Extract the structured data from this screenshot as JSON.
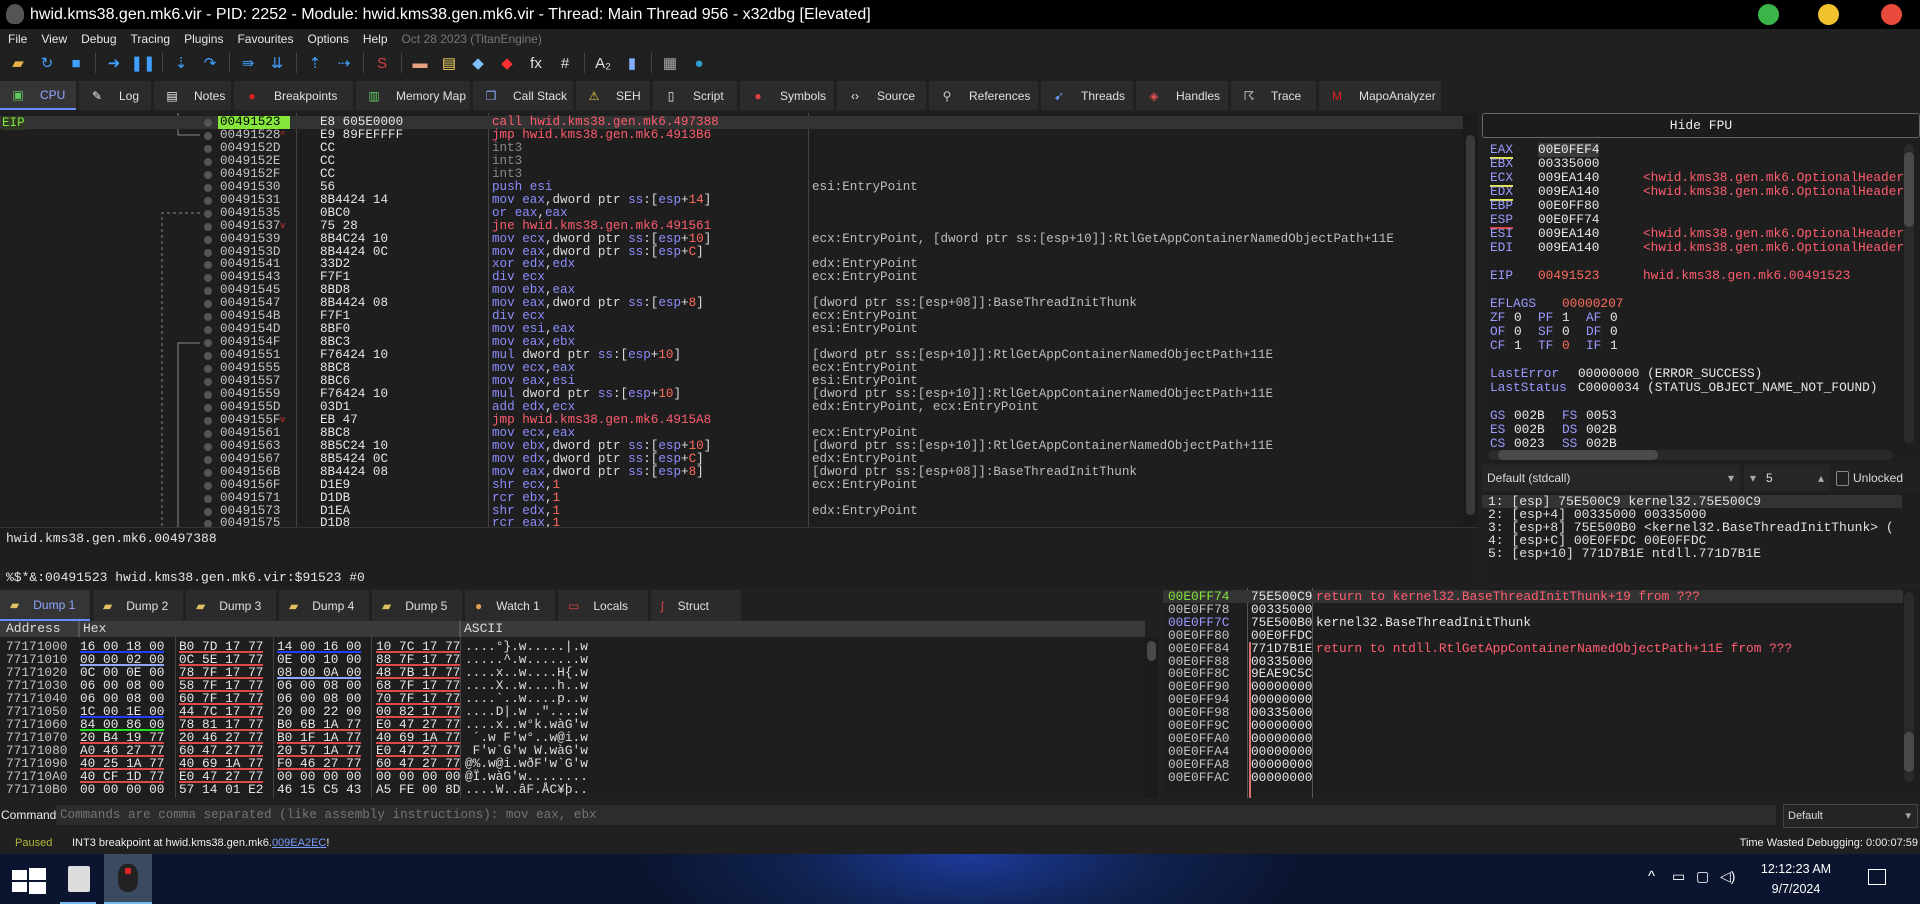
{
  "window": {
    "title": "hwid.kms38.gen.mk6.vir - PID: 2252 - Module: hwid.kms38.gen.mk6.vir - Thread: Main Thread 956 - x32dbg [Elevated]",
    "controls": {
      "minimize": "#3bb54a",
      "maximize": "#f2c12e",
      "close": "#e84b3c"
    }
  },
  "menu": {
    "items": [
      "File",
      "View",
      "Debug",
      "Tracing",
      "Plugins",
      "Favourites",
      "Options",
      "Help"
    ],
    "version": "Oct 28 2023 (TitanEngine)"
  },
  "toolbar": [
    {
      "icon": "open-folder-icon",
      "g": "▰",
      "c": "#e8b44a"
    },
    {
      "icon": "restart-icon",
      "g": "↻",
      "c": "#3fa0ff"
    },
    {
      "icon": "stop-icon",
      "g": "■",
      "c": "#3fa0ff"
    },
    {
      "sep": true
    },
    {
      "icon": "run-icon",
      "g": "➜",
      "c": "#3fa0ff"
    },
    {
      "icon": "pause-icon",
      "g": "❚❚",
      "c": "#3fa0ff"
    },
    {
      "sep": true
    },
    {
      "icon": "step-into-icon",
      "g": "⇣",
      "c": "#3fa0ff"
    },
    {
      "icon": "step-over-icon",
      "g": "↷",
      "c": "#3fa0ff"
    },
    {
      "sep": true
    },
    {
      "icon": "trace-into-icon",
      "g": "⇛",
      "c": "#3fa0ff"
    },
    {
      "icon": "trace-over-icon",
      "g": "⇊",
      "c": "#3fa0ff"
    },
    {
      "sep": true
    },
    {
      "icon": "execute-till-return-icon",
      "g": "⇡",
      "c": "#3fa0ff"
    },
    {
      "icon": "run-to-user-code-icon",
      "g": "⇢",
      "c": "#3fa0ff"
    },
    {
      "sep": true
    },
    {
      "icon": "scylla-icon",
      "g": "S",
      "c": "#d04040"
    },
    {
      "sep": true
    },
    {
      "icon": "patch-icon",
      "g": "▬",
      "c": "#e8a080"
    },
    {
      "icon": "comment-icon",
      "g": "▤",
      "c": "#f0d060"
    },
    {
      "icon": "label-icon",
      "g": "◆",
      "c": "#80c0ff"
    },
    {
      "icon": "bookmark-icon",
      "g": "◆",
      "c": "#ff3030"
    },
    {
      "icon": "function-icon",
      "g": "fx",
      "c": "#e0e0e0"
    },
    {
      "icon": "hash-icon",
      "g": "#",
      "c": "#e0e0e0"
    },
    {
      "sep": true
    },
    {
      "icon": "strings-icon",
      "g": "A₂",
      "c": "#e0e0e0"
    },
    {
      "icon": "calls-icon",
      "g": "▮",
      "c": "#80b0ff"
    },
    {
      "sep": true
    },
    {
      "icon": "calculator-icon",
      "g": "▦",
      "c": "#aaaaaa"
    },
    {
      "icon": "globe-icon",
      "g": "●",
      "c": "#30a0d0"
    }
  ],
  "tabs": [
    {
      "label": "CPU",
      "icon": "cpu-icon",
      "g": "▣",
      "c": "#5fc85f",
      "active": true
    },
    {
      "label": "Log",
      "icon": "log-icon",
      "g": "✎",
      "c": "#eee"
    },
    {
      "label": "Notes",
      "icon": "notes-icon",
      "g": "▤",
      "c": "#eee"
    },
    {
      "label": "Breakpoints",
      "icon": "breakpoint-icon",
      "g": "●",
      "c": "#e02020"
    },
    {
      "label": "Memory Map",
      "icon": "memory-map-icon",
      "g": "▥",
      "c": "#5fc85f"
    },
    {
      "label": "Call Stack",
      "icon": "call-stack-icon",
      "g": "❐",
      "c": "#8aa8ff"
    },
    {
      "label": "SEH",
      "icon": "seh-icon",
      "g": "⚠",
      "c": "#f0d040"
    },
    {
      "label": "Script",
      "icon": "script-icon",
      "g": "▯",
      "c": "#eee"
    },
    {
      "label": "Symbols",
      "icon": "symbols-icon",
      "g": "●",
      "c": "#e04040"
    },
    {
      "label": "Source",
      "icon": "source-icon",
      "g": "‹›",
      "c": "#eee"
    },
    {
      "label": "References",
      "icon": "references-icon",
      "g": "⚲",
      "c": "#ccc"
    },
    {
      "label": "Threads",
      "icon": "threads-icon",
      "g": "➹",
      "c": "#6a9cff"
    },
    {
      "label": "Handles",
      "icon": "handles-icon",
      "g": "◈",
      "c": "#e05050"
    },
    {
      "label": "Trace",
      "icon": "trace-icon",
      "g": "☈",
      "c": "#ccc"
    },
    {
      "label": "MapoAnalyzer",
      "icon": "mapo-analyzer-icon",
      "g": "M",
      "c": "#e02020"
    }
  ],
  "disasm": {
    "eip_label": "EIP",
    "rows": [
      [
        "00491523",
        "E8 605E0000",
        "call hwid.kms38.gen.mk6.497388",
        "",
        "red"
      ],
      [
        "00491528",
        "E9 89FEFFFF",
        "jmp hwid.kms38.gen.mk6.4913B6",
        "",
        "red"
      ],
      [
        "0049152D",
        "CC",
        "int3",
        "",
        "gray"
      ],
      [
        "0049152E",
        "CC",
        "int3",
        "",
        "gray"
      ],
      [
        "0049152F",
        "CC",
        "int3",
        "",
        "gray"
      ],
      [
        "00491530",
        "56",
        "push esi",
        "esi:EntryPoint",
        "blue"
      ],
      [
        "00491531",
        "8B4424 14",
        "mov eax,dword ptr ss:[esp+14]",
        "",
        "blue"
      ],
      [
        "00491535",
        "0BC0",
        "or eax,eax",
        "",
        "blue"
      ],
      [
        "00491537",
        "75 28",
        "jne hwid.kms38.gen.mk6.491561",
        "",
        "red"
      ],
      [
        "00491539",
        "8B4C24 10",
        "mov ecx,dword ptr ss:[esp+10]",
        "ecx:EntryPoint, [dword ptr ss:[esp+10]]:RtlGetAppContainerNamedObjectPath+11E",
        "blue"
      ],
      [
        "0049153D",
        "8B4424 0C",
        "mov eax,dword ptr ss:[esp+C]",
        "",
        "blue"
      ],
      [
        "00491541",
        "33D2",
        "xor edx,edx",
        "edx:EntryPoint",
        "blue"
      ],
      [
        "00491543",
        "F7F1",
        "div ecx",
        "ecx:EntryPoint",
        "blue"
      ],
      [
        "00491545",
        "8BD8",
        "mov ebx,eax",
        "",
        "blue"
      ],
      [
        "00491547",
        "8B4424 08",
        "mov eax,dword ptr ss:[esp+8]",
        "[dword ptr ss:[esp+08]]:BaseThreadInitThunk",
        "blue"
      ],
      [
        "0049154B",
        "F7F1",
        "div ecx",
        "ecx:EntryPoint",
        "blue"
      ],
      [
        "0049154D",
        "8BF0",
        "mov esi,eax",
        "esi:EntryPoint",
        "blue"
      ],
      [
        "0049154F",
        "8BC3",
        "mov eax,ebx",
        "",
        "blue"
      ],
      [
        "00491551",
        "F76424 10",
        "mul dword ptr ss:[esp+10]",
        "[dword ptr ss:[esp+10]]:RtlGetAppContainerNamedObjectPath+11E",
        "blue"
      ],
      [
        "00491555",
        "8BC8",
        "mov ecx,eax",
        "ecx:EntryPoint",
        "blue"
      ],
      [
        "00491557",
        "8BC6",
        "mov eax,esi",
        "esi:EntryPoint",
        "blue"
      ],
      [
        "00491559",
        "F76424 10",
        "mul dword ptr ss:[esp+10]",
        "[dword ptr ss:[esp+10]]:RtlGetAppContainerNamedObjectPath+11E",
        "blue"
      ],
      [
        "0049155D",
        "03D1",
        "add edx,ecx",
        "edx:EntryPoint, ecx:EntryPoint",
        "blue"
      ],
      [
        "0049155F",
        "EB 47",
        "jmp hwid.kms38.gen.mk6.4915A8",
        "",
        "red"
      ],
      [
        "00491561",
        "8BC8",
        "mov ecx,eax",
        "ecx:EntryPoint",
        "blue"
      ],
      [
        "00491563",
        "8B5C24 10",
        "mov ebx,dword ptr ss:[esp+10]",
        "[dword ptr ss:[esp+10]]:RtlGetAppContainerNamedObjectPath+11E",
        "blue"
      ],
      [
        "00491567",
        "8B5424 0C",
        "mov edx,dword ptr ss:[esp+C]",
        "edx:EntryPoint",
        "blue"
      ],
      [
        "0049156B",
        "8B4424 08",
        "mov eax,dword ptr ss:[esp+8]",
        "[dword ptr ss:[esp+08]]:BaseThreadInitThunk",
        "blue"
      ],
      [
        "0049156F",
        "D1E9",
        "shr ecx,1",
        "ecx:EntryPoint",
        "blue"
      ],
      [
        "00491571",
        "D1DB",
        "rcr ebx,1",
        "",
        "blue"
      ],
      [
        "00491573",
        "D1EA",
        "shr edx,1",
        "edx:EntryPoint",
        "blue"
      ],
      [
        "00491575",
        "D1D8",
        "rcr eax,1",
        "",
        "blue"
      ]
    ]
  },
  "info": {
    "line1": "hwid.kms38.gen.mk6.00497388",
    "line2": "%$*&:00491523 hwid.kms38.gen.mk6.vir:$91523 #0"
  },
  "registers": {
    "hide_fpu": "Hide FPU",
    "gp": [
      [
        "EAX",
        "00E0FEF4",
        "",
        "y"
      ],
      [
        "EBX",
        "00335000",
        "",
        ""
      ],
      [
        "ECX",
        "009EA140",
        "<hwid.kms38.gen.mk6.OptionalHeader",
        "y"
      ],
      [
        "EDX",
        "009EA140",
        "<hwid.kms38.gen.mk6.OptionalHeader",
        "y"
      ],
      [
        "EBP",
        "00E0FF80",
        "",
        ""
      ],
      [
        "ESP",
        "00E0FF74",
        "",
        "r"
      ],
      [
        "ESI",
        "009EA140",
        "<hwid.kms38.gen.mk6.OptionalHeader",
        ""
      ],
      [
        "EDI",
        "009EA140",
        "<hwid.kms38.gen.mk6.OptionalHeader",
        ""
      ]
    ],
    "eip": [
      "EIP",
      "00491523",
      "hwid.kms38.gen.mk6.00491523"
    ],
    "eflags": [
      "EFLAGS",
      "00000207"
    ],
    "flags": [
      [
        [
          "ZF",
          "0"
        ],
        [
          "PF",
          "1"
        ],
        [
          "AF",
          "0"
        ]
      ],
      [
        [
          "OF",
          "0"
        ],
        [
          "SF",
          "0"
        ],
        [
          "DF",
          "0"
        ]
      ],
      [
        [
          "CF",
          "1"
        ],
        [
          "TF",
          "0"
        ],
        [
          "IF",
          "1"
        ]
      ]
    ],
    "last_error": [
      "LastError",
      "00000000 (ERROR_SUCCESS)"
    ],
    "last_status": [
      "LastStatus",
      "C0000034 (STATUS_OBJECT_NAME_NOT_FOUND)"
    ],
    "segs": [
      [
        [
          "GS",
          "002B"
        ],
        [
          "FS",
          "0053"
        ]
      ],
      [
        [
          "ES",
          "002B"
        ],
        [
          "DS",
          "002B"
        ]
      ],
      [
        [
          "CS",
          "0023"
        ],
        [
          "SS",
          "002B"
        ]
      ]
    ]
  },
  "callconv": {
    "selected": "Default (stdcall)",
    "arg_count": "5",
    "unlocked_label": "Unlocked"
  },
  "args": [
    "1: [esp] 75E500C9 kernel32.75E500C9",
    "2: [esp+4] 00335000 00335000",
    "3: [esp+8] 75E500B0 <kernel32.BaseThreadInitThunk> (",
    "4: [esp+C] 00E0FFDC 00E0FFDC",
    "5: [esp+10] 771D7B1E ntdll.771D7B1E"
  ],
  "dump_tabs": [
    {
      "label": "Dump 1",
      "icon": "dump-icon",
      "active": true
    },
    {
      "label": "Dump 2",
      "icon": "dump-icon"
    },
    {
      "label": "Dump 3",
      "icon": "dump-icon"
    },
    {
      "label": "Dump 4",
      "icon": "dump-icon"
    },
    {
      "label": "Dump 5",
      "icon": "dump-icon"
    },
    {
      "label": "Watch 1",
      "icon": "watch-icon"
    },
    {
      "label": "Locals",
      "icon": "locals-icon"
    },
    {
      "label": "Struct",
      "icon": "struct-icon"
    }
  ],
  "dump": {
    "headers": [
      "Address",
      "Hex",
      "ASCII"
    ],
    "underline_colors": {
      "b": "#1f3fff",
      "l": "#8fa6ff",
      "r": "#e04848",
      "g": "#22dd22"
    },
    "rows": [
      [
        "77171000",
        [
          "16 00 18 00",
          "B0 7D 17 77",
          "14 00 16 00",
          "10 7C 17 77"
        ],
        "brbr",
        "....°}.w.....|.w"
      ],
      [
        "77171010",
        [
          "00 00 02 00",
          "0C 5E 17 77",
          "0E 00 10 00",
          "88 7F 17 77"
        ],
        "lr-r",
        ".....^.w.......w"
      ],
      [
        "77171020",
        [
          "0C 00 0E 00",
          "78 7F 17 77",
          "08 00 0A 00",
          "48 7B 17 77"
        ],
        "-rlr",
        "....x..w....H{.w"
      ],
      [
        "77171030",
        [
          "06 00 08 00",
          "58 7F 17 77",
          "06 00 08 00",
          "68 7F 17 77"
        ],
        "-r-r",
        "....X..w....h..w"
      ],
      [
        "77171040",
        [
          "06 00 08 00",
          "60 7F 17 77",
          "06 00 08 00",
          "70 7F 17 77"
        ],
        "-r-r",
        "....`..w....p..w"
      ],
      [
        "77171050",
        [
          "1C 00 1E 00",
          "44 7C 17 77",
          "20 00 22 00",
          "00 82 17 77"
        ],
        "br-r",
        "....D|.w .\"....w"
      ],
      [
        "77171060",
        [
          "84 00 86 00",
          "78 81 17 77",
          "B0 6B 1A 77",
          "E0 47 27 77"
        ],
        "grrr",
        "....x..w°k.wàG'w"
      ],
      [
        "77171070",
        [
          "20 B4 19 77",
          "20 46 27 77",
          "B0 1F 1A 77",
          "40 69 1A 77"
        ],
        "rrrr",
        " ´.w F'w°..w@i.w"
      ],
      [
        "77171080",
        [
          "A0 46 27 77",
          "60 47 27 77",
          "20 57 1A 77",
          "E0 47 27 77"
        ],
        "rrrr",
        " F'w`G'w W.wàG'w"
      ],
      [
        "77171090",
        [
          "40 25 1A 77",
          "40 69 1A 77",
          "F0 46 27 77",
          "60 47 27 77"
        ],
        "rrrr",
        "@%.w@i.wðF'w`G'w"
      ],
      [
        "771710A0",
        [
          "40 CF 1D 77",
          "E0 47 27 77",
          "00 00 00 00",
          "00 00 00 00"
        ],
        "rr--",
        "@Ï.wàG'w........"
      ],
      [
        "771710B0",
        [
          "00 00 00 00",
          "57 14 01 E2",
          "46 15 C5 43",
          "A5 FE 00 8D"
        ],
        "----",
        "....W..âF.ÅC¥þ.."
      ]
    ]
  },
  "stack": {
    "rows": [
      [
        "00E0FF74",
        "75E500C9",
        "return to kernel32.BaseThreadInitThunk+19 from ???",
        "ret"
      ],
      [
        "00E0FF78",
        "00335000",
        "",
        ""
      ],
      [
        "00E0FF7C",
        "75E500B0",
        "kernel32.BaseThreadInitThunk",
        "sym"
      ],
      [
        "00E0FF80",
        "00E0FFDC",
        "",
        ""
      ],
      [
        "00E0FF84",
        "771D7B1E",
        "return to ntdll.RtlGetAppContainerNamedObjectPath+11E from ???",
        "ret"
      ],
      [
        "00E0FF88",
        "00335000",
        "",
        ""
      ],
      [
        "00E0FF8C",
        "9EAE9C5C",
        "",
        ""
      ],
      [
        "00E0FF90",
        "00000000",
        "",
        ""
      ],
      [
        "00E0FF94",
        "00000000",
        "",
        ""
      ],
      [
        "00E0FF98",
        "00335000",
        "",
        ""
      ],
      [
        "00E0FF9C",
        "00000000",
        "",
        ""
      ],
      [
        "00E0FFA0",
        "00000000",
        "",
        ""
      ],
      [
        "00E0FFA4",
        "00000000",
        "",
        ""
      ],
      [
        "00E0FFA8",
        "00000000",
        "",
        ""
      ],
      [
        "00E0FFAC",
        "00000000",
        "",
        ""
      ]
    ]
  },
  "command": {
    "label": "Command:",
    "placeholder": "Commands are comma separated (like assembly instructions): mov eax, ebx",
    "mode": "Default"
  },
  "status": {
    "state": "Paused",
    "message": "INT3 breakpoint at hwid.kms38.gen.mk6.",
    "link": "009EA2EC",
    "suffix": "!",
    "time_wasted": "Time Wasted Debugging: 0:00:07:59"
  },
  "taskbar": {
    "time": "12:12:23 AM",
    "date": "9/7/2024"
  }
}
